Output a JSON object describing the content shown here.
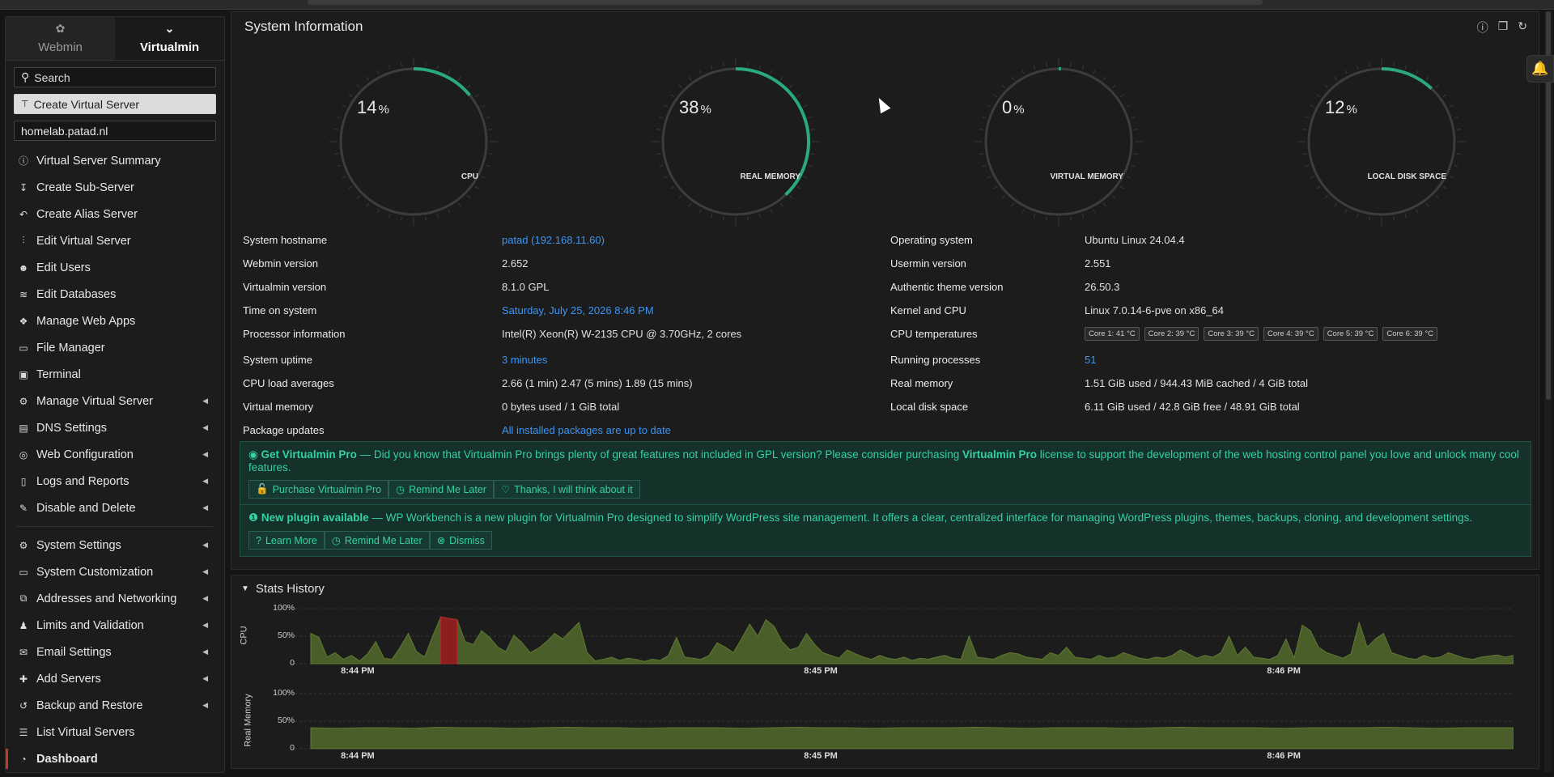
{
  "sidebar": {
    "tabs": [
      {
        "label": "Webmin",
        "icon": "webmin-logo-icon"
      },
      {
        "label": "Virtualmin",
        "icon": "chevron-down-icon"
      }
    ],
    "search_placeholder": "Search",
    "create_label": "Create Virtual Server",
    "domain": "homelab.patad.nl",
    "items": [
      {
        "label": "Virtual Server Summary",
        "icon": "info-icon",
        "sub": false
      },
      {
        "label": "Create Sub-Server",
        "icon": "arrow-down-icon",
        "sub": false
      },
      {
        "label": "Create Alias Server",
        "icon": "reply-icon",
        "sub": false
      },
      {
        "label": "Edit Virtual Server",
        "icon": "sliders-icon",
        "sub": false
      },
      {
        "label": "Edit Users",
        "icon": "users-icon",
        "sub": false
      },
      {
        "label": "Edit Databases",
        "icon": "database-icon",
        "sub": false
      },
      {
        "label": "Manage Web Apps",
        "icon": "cubes-icon",
        "sub": false
      },
      {
        "label": "File Manager",
        "icon": "folder-icon",
        "sub": false
      },
      {
        "label": "Terminal",
        "icon": "terminal-icon",
        "sub": false
      },
      {
        "label": "Manage Virtual Server",
        "icon": "cogs-icon",
        "sub": true
      },
      {
        "label": "DNS Settings",
        "icon": "dns-icon",
        "sub": true
      },
      {
        "label": "Web Configuration",
        "icon": "globe-icon",
        "sub": true
      },
      {
        "label": "Logs and Reports",
        "icon": "file-icon",
        "sub": true
      },
      {
        "label": "Disable and Delete",
        "icon": "brush-icon",
        "sub": true
      }
    ],
    "items2": [
      {
        "label": "System Settings",
        "icon": "gear-icon",
        "sub": true
      },
      {
        "label": "System Customization",
        "icon": "monitor-icon",
        "sub": true
      },
      {
        "label": "Addresses and Networking",
        "icon": "network-icon",
        "sub": true
      },
      {
        "label": "Limits and Validation",
        "icon": "user-lock-icon",
        "sub": true
      },
      {
        "label": "Email Settings",
        "icon": "envelope-icon",
        "sub": true
      },
      {
        "label": "Add Servers",
        "icon": "plus-icon",
        "sub": true
      },
      {
        "label": "Backup and Restore",
        "icon": "history-icon",
        "sub": true
      },
      {
        "label": "List Virtual Servers",
        "icon": "list-icon",
        "sub": false
      },
      {
        "label": "Dashboard",
        "icon": "dashboard-icon",
        "sub": false
      }
    ]
  },
  "sysinfo": {
    "title": "System Information",
    "gauges": [
      {
        "value": 14,
        "unit": "%",
        "label": "CPU"
      },
      {
        "value": 38,
        "unit": "%",
        "label": "REAL MEMORY"
      },
      {
        "value": 0,
        "unit": "%",
        "label": "VIRTUAL MEMORY"
      },
      {
        "value": 12,
        "unit": "%",
        "label": "LOCAL DISK SPACE"
      }
    ],
    "rows": [
      {
        "l1": "System hostname",
        "v1": "patad (192.168.11.60)",
        "v1link": true,
        "l2": "Operating system",
        "v2": "Ubuntu Linux 24.04.4"
      },
      {
        "l1": "Webmin version",
        "v1": "2.652",
        "l2": "Usermin version",
        "v2": "2.551"
      },
      {
        "l1": "Virtualmin version",
        "v1": "8.1.0 GPL",
        "l2": "Authentic theme version",
        "v2": "26.50.3"
      },
      {
        "l1": "Time on system",
        "v1": "Saturday, July 25, 2026 8:46 PM",
        "v1link": true,
        "l2": "Kernel and CPU",
        "v2": "Linux 7.0.14-6-pve on x86_64"
      },
      {
        "l1": "Processor information",
        "v1": "Intel(R) Xeon(R) W-2135 CPU @ 3.70GHz, 2 cores",
        "l2": "CPU temperatures",
        "v2": ""
      },
      {
        "l1": "System uptime",
        "v1": "3 minutes",
        "v1link": true,
        "l2": "Running processes",
        "v2": "51",
        "v2link": true
      },
      {
        "l1": "CPU load averages",
        "v1": "2.66 (1 min) 2.47 (5 mins) 1.89 (15 mins)",
        "l2": "Real memory",
        "v2": "1.51 GiB used / 944.43 MiB cached / 4 GiB total"
      },
      {
        "l1": "Virtual memory",
        "v1": "0 bytes used / 1 GiB total",
        "l2": "Local disk space",
        "v2": "6.11 GiB used / 42.8 GiB free / 48.91 GiB total"
      },
      {
        "l1": "Package updates",
        "v1": "All installed packages are up to date",
        "v1link": true,
        "l2": "",
        "v2": ""
      }
    ],
    "temps": [
      "Core 1: 41 °C",
      "Core 2: 39 °C",
      "Core 3: 39 °C",
      "Core 4: 39 °C",
      "Core 5: 39 °C",
      "Core 6: 39 °C"
    ],
    "pro_alert": {
      "title": "Get Virtualmin Pro",
      "text_a": " — Did you know that Virtualmin Pro brings plenty of great features not included in GPL version? Please consider purchasing ",
      "bold": "Virtualmin Pro",
      "text_b": " license to support the development of the web hosting control panel you love and unlock many cool features.",
      "buttons": [
        "Purchase Virtualmin Pro",
        "Remind Me Later",
        "Thanks, I will think about it"
      ]
    },
    "plugin_alert": {
      "title": "New plugin available",
      "text": " — WP Workbench is a new plugin for Virtualmin Pro designed to simplify WordPress site management. It offers a clear, centralized interface for managing WordPress plugins, themes, backups, cloning, and development settings.",
      "buttons": [
        "Learn More",
        "Remind Me Later",
        "Dismiss"
      ]
    }
  },
  "stats": {
    "title": "Stats History",
    "xticks": [
      "8:44 PM",
      "8:45 PM",
      "8:46 PM"
    ],
    "yticks": [
      "100%",
      "50%",
      "0"
    ]
  },
  "chart_data": [
    {
      "type": "area",
      "ylabel": "CPU",
      "ylim": [
        0,
        100
      ],
      "x_ticks": [
        "8:44 PM",
        "8:45 PM",
        "8:46 PM"
      ],
      "values": [
        55,
        48,
        12,
        20,
        8,
        15,
        5,
        18,
        40,
        10,
        8,
        30,
        55,
        22,
        12,
        50,
        85,
        82,
        80,
        40,
        35,
        60,
        48,
        30,
        22,
        52,
        38,
        20,
        28,
        40,
        55,
        45,
        60,
        75,
        20,
        5,
        8,
        12,
        6,
        10,
        8,
        4,
        8,
        6,
        15,
        48,
        12,
        10,
        8,
        15,
        38,
        30,
        20,
        45,
        72,
        50,
        80,
        68,
        40,
        25,
        30,
        55,
        35,
        20,
        15,
        10,
        25,
        18,
        12,
        8,
        15,
        10,
        8,
        12,
        6,
        10,
        8,
        12,
        15,
        10,
        8,
        50,
        12,
        10,
        8,
        15,
        20,
        18,
        12,
        10,
        8,
        20,
        15,
        30,
        12,
        10,
        8,
        15,
        10,
        12,
        20,
        15,
        10,
        8,
        12,
        10,
        15,
        25,
        18,
        10,
        15,
        12,
        20,
        50,
        15,
        30,
        12,
        10,
        8,
        15,
        45,
        10,
        70,
        60,
        30,
        20,
        15,
        10,
        18,
        75,
        30,
        45,
        55,
        20,
        15,
        10,
        8,
        15,
        10,
        12,
        20,
        15,
        10,
        8,
        12,
        14,
        16,
        12,
        15
      ],
      "highlight_range": [
        16,
        18
      ],
      "color": "#4a5e2a"
    },
    {
      "type": "area",
      "ylabel": "Real Memory",
      "ylim": [
        0,
        100
      ],
      "x_ticks": [
        "8:44 PM",
        "8:45 PM",
        "8:46 PM"
      ],
      "values": [
        38,
        37,
        38,
        38,
        37,
        39,
        38,
        38,
        37,
        38,
        39,
        38,
        38,
        37,
        38,
        38,
        38,
        37,
        38,
        39,
        38,
        38,
        37,
        38,
        38,
        38,
        39,
        38,
        37,
        38,
        38,
        38,
        37,
        38,
        39,
        38,
        38,
        38,
        37,
        38,
        38,
        38,
        39,
        38,
        37,
        38,
        38,
        38
      ],
      "color": "#4a5e2a"
    }
  ],
  "colors": {
    "accent": "#2aa87e",
    "link": "#3a96f5",
    "alert_text": "#36d1a0",
    "active_marker": "#c0392b"
  }
}
